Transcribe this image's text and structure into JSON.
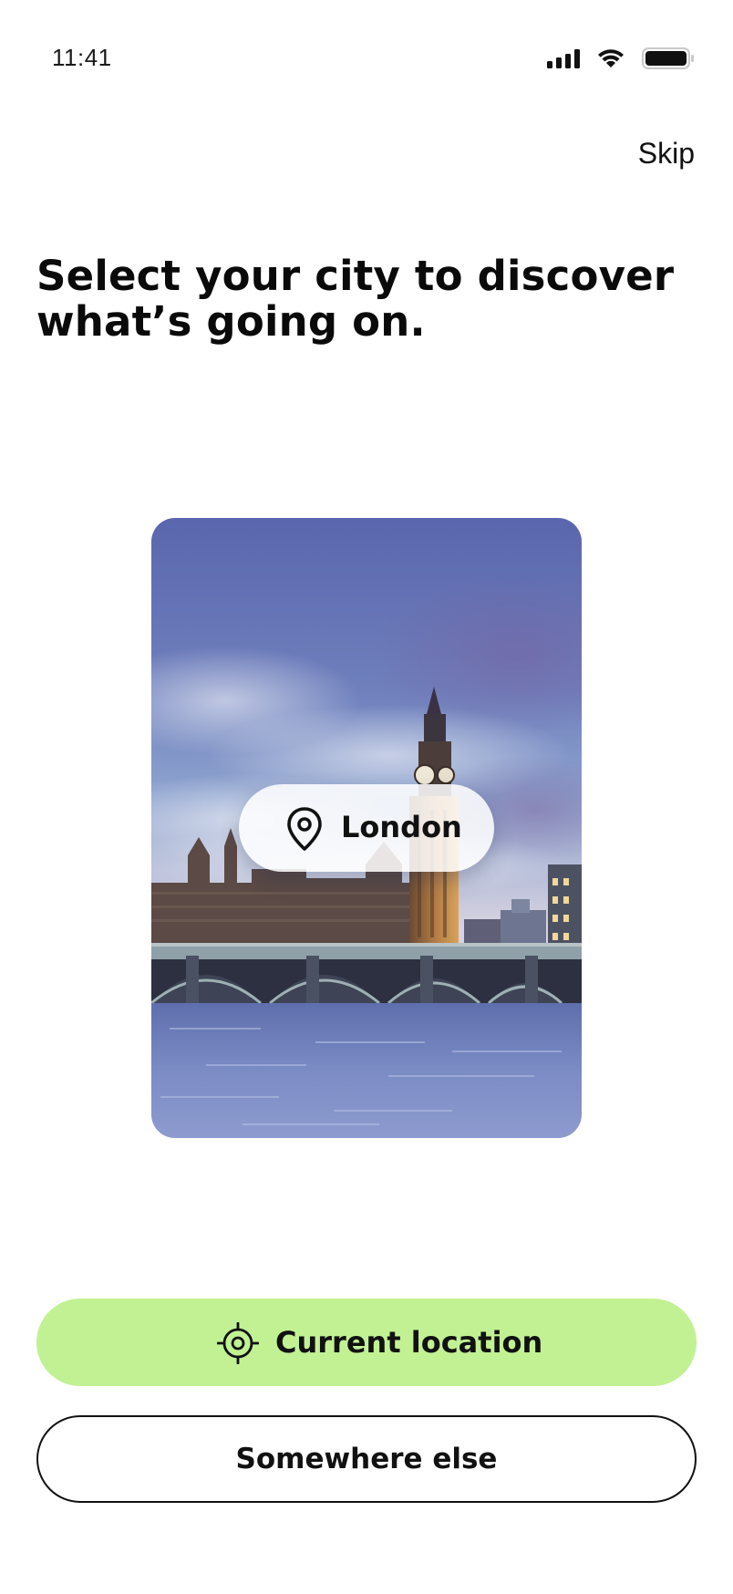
{
  "status_bar": {
    "time": "11:41",
    "icons": [
      "cellular-signal-icon",
      "wifi-icon",
      "battery-icon"
    ]
  },
  "header": {
    "skip_label": "Skip"
  },
  "main": {
    "headline": "Select your city to discover what’s going on.",
    "city_card": {
      "city_name": "London",
      "icon": "map-pin-icon",
      "image": "london-westminster-photo"
    }
  },
  "actions": {
    "current_location_label": "Current location",
    "current_location_icon": "crosshair-location-icon",
    "somewhere_else_label": "Somewhere else"
  },
  "colors": {
    "accent": "#c2f194",
    "text": "#111111",
    "background": "#ffffff"
  }
}
